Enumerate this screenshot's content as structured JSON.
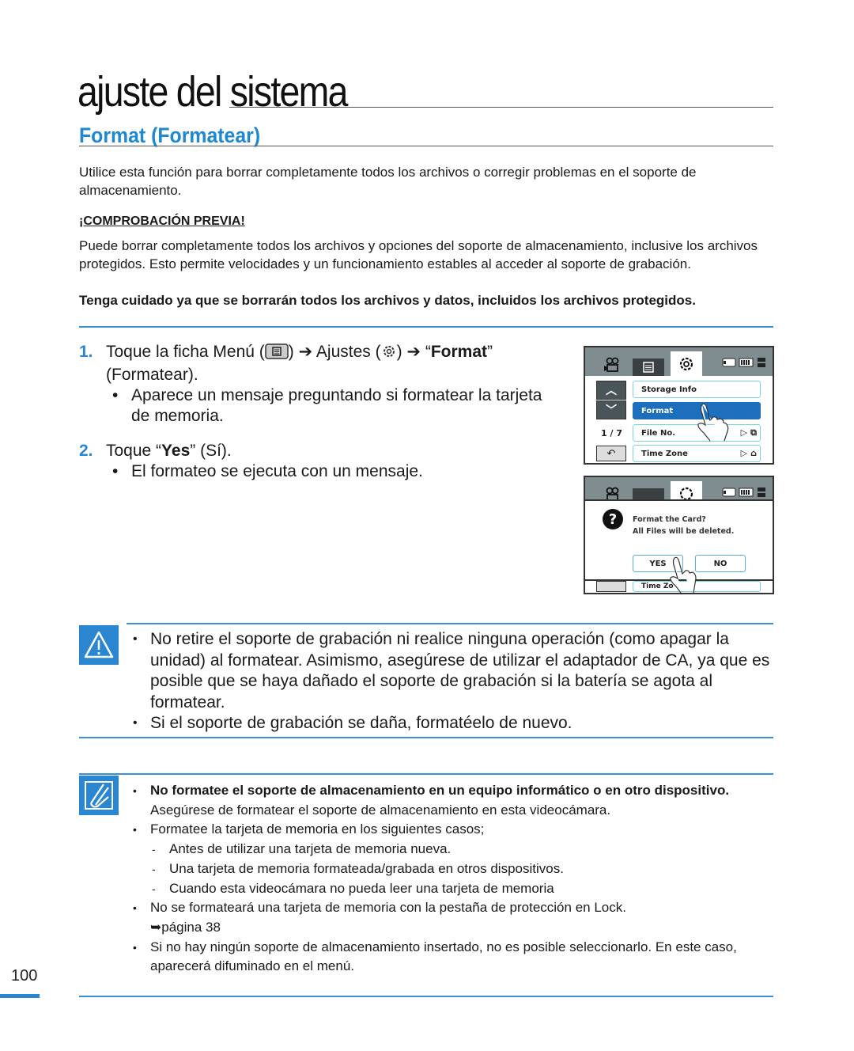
{
  "header": {
    "chapter_title": "ajuste del sistema",
    "section_title": "Format (Formatear)"
  },
  "intro": "Utilice esta función para borrar completamente todos los archivos o corregir problemas en el soporte de almacenamiento.",
  "precheck": {
    "heading": "¡COMPROBACIÓN PREVIA!",
    "body": "Puede borrar completamente todos los archivos y opciones del soporte de almacenamiento, inclusive los archivos protegidos. Esto permite velocidades y un funcionamiento estables al acceder al soporte de grabación.",
    "warning_bold": "Tenga cuidado ya que se borrarán todos los archivos y datos, incluidos los archivos protegidos."
  },
  "steps": [
    {
      "number": "1.",
      "text_a": "Toque la ficha Menú (",
      "text_b": ") ➔ Ajustes (",
      "text_c": ") ➔ “",
      "bold": "Format",
      "text_d": "” (Formatear).",
      "sub": "Aparece un mensaje preguntando si formatear la tarjeta de memoria."
    },
    {
      "number": "2.",
      "text_a": "Toque “",
      "bold": "Yes",
      "text_b": "” (Sí).",
      "sub": "El formateo se ejecuta con un mensaje."
    }
  ],
  "screen1": {
    "page_indicator": "1 / 7",
    "menu_items": [
      "Storage Info",
      "Format",
      "File No.",
      "Time Zone"
    ],
    "selected_item": "Format"
  },
  "screen2": {
    "dialog_line1": "Format the Card?",
    "dialog_line2": "All Files will be deleted.",
    "yes_label": "YES",
    "no_label": "NO",
    "behind_item": "Time Zo"
  },
  "warning": {
    "items": [
      "No retire el soporte de grabación ni realice ninguna operación (como apagar la unidad) al formatear. Asimismo, asegúrese de utilizar el adaptador de CA, ya que es posible que se haya dañado el soporte de grabación si la batería se agota al formatear.",
      "Si el soporte de grabación se daña, formatéelo de nuevo."
    ]
  },
  "tips": {
    "item1_bold": "No formatee el soporte de almacenamiento en un equipo informático o en otro dispositivo.",
    "item1_text": "Asegúrese de formatear el soporte de almacenamiento en esta videocámara.",
    "item2": "Formatee la tarjeta de memoria en los siguientes casos;",
    "item2_subs": [
      "Antes de utilizar una tarjeta de memoria nueva.",
      "Una tarjeta de memoria formateada/grabada en otros dispositivos.",
      "Cuando esta videocámara no pueda leer una tarjeta de memoria"
    ],
    "item3": "No se formateará una tarjeta de memoria con la pestaña de protección en Lock.",
    "item3_ref": "➥página 38",
    "item4": "Si no hay ningún soporte de almacenamiento insertado, no es posible seleccionarlo. En este caso, aparecerá difuminado en el menú."
  },
  "footer": {
    "page_number": "100"
  },
  "colors": {
    "accent": "#1e88d0",
    "rule": "#3a8fd6",
    "selected_menu": "#1b6fbd"
  }
}
